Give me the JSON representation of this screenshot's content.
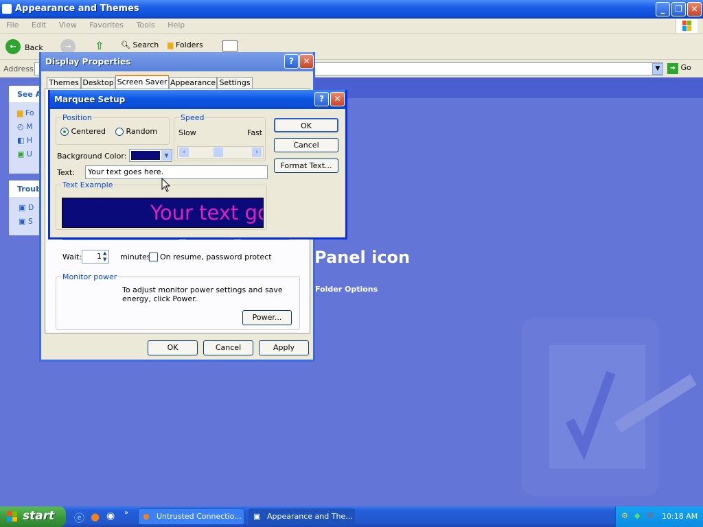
{
  "window": {
    "title": "Appearance and Themes"
  },
  "menu": [
    "File",
    "Edit",
    "View",
    "Favorites",
    "Tools",
    "Help"
  ],
  "toolbar": {
    "back": "Back",
    "search": "Search",
    "folders": "Folders"
  },
  "address": {
    "label": "Address",
    "go": "Go"
  },
  "sidebar": {
    "see_also": "See A",
    "troubleshooters": "Troub",
    "see_items": [
      "Fo",
      "M",
      "H",
      "U"
    ],
    "trouble_items": [
      "D",
      "S"
    ]
  },
  "main": {
    "heading_fragment": "Panel icon",
    "link": "Folder Options"
  },
  "display_properties": {
    "title": "Display Properties",
    "tabs": [
      "Themes",
      "Desktop",
      "Screen Saver",
      "Appearance",
      "Settings"
    ],
    "active_tab": "Screen Saver",
    "wait_label": "Wait:",
    "wait_value": "1",
    "minutes_label": "minutes",
    "resume_label": "On resume, password protect",
    "monitor_power": {
      "title": "Monitor power",
      "text": "To adjust monitor power settings and save energy, click Power.",
      "button": "Power..."
    },
    "buttons": {
      "ok": "OK",
      "cancel": "Cancel",
      "apply": "Apply"
    }
  },
  "marquee": {
    "title": "Marquee Setup",
    "position": {
      "title": "Position",
      "centered": "Centered",
      "random": "Random",
      "selected": "Centered"
    },
    "speed": {
      "title": "Speed",
      "slow": "Slow",
      "fast": "Fast"
    },
    "background_color_label": "Background Color:",
    "background_color": "#0a0a7a",
    "text_label": "Text:",
    "text_value": "Your text goes here.",
    "example": {
      "title": "Text Example",
      "preview": "Your text go",
      "color": "#e020c0"
    },
    "buttons": {
      "ok": "OK",
      "cancel": "Cancel",
      "format_text": "Format Text..."
    }
  },
  "taskbar": {
    "start": "start",
    "tasks": [
      "Untrusted Connectio...",
      "Appearance and The..."
    ],
    "clock": "10:18 AM"
  }
}
